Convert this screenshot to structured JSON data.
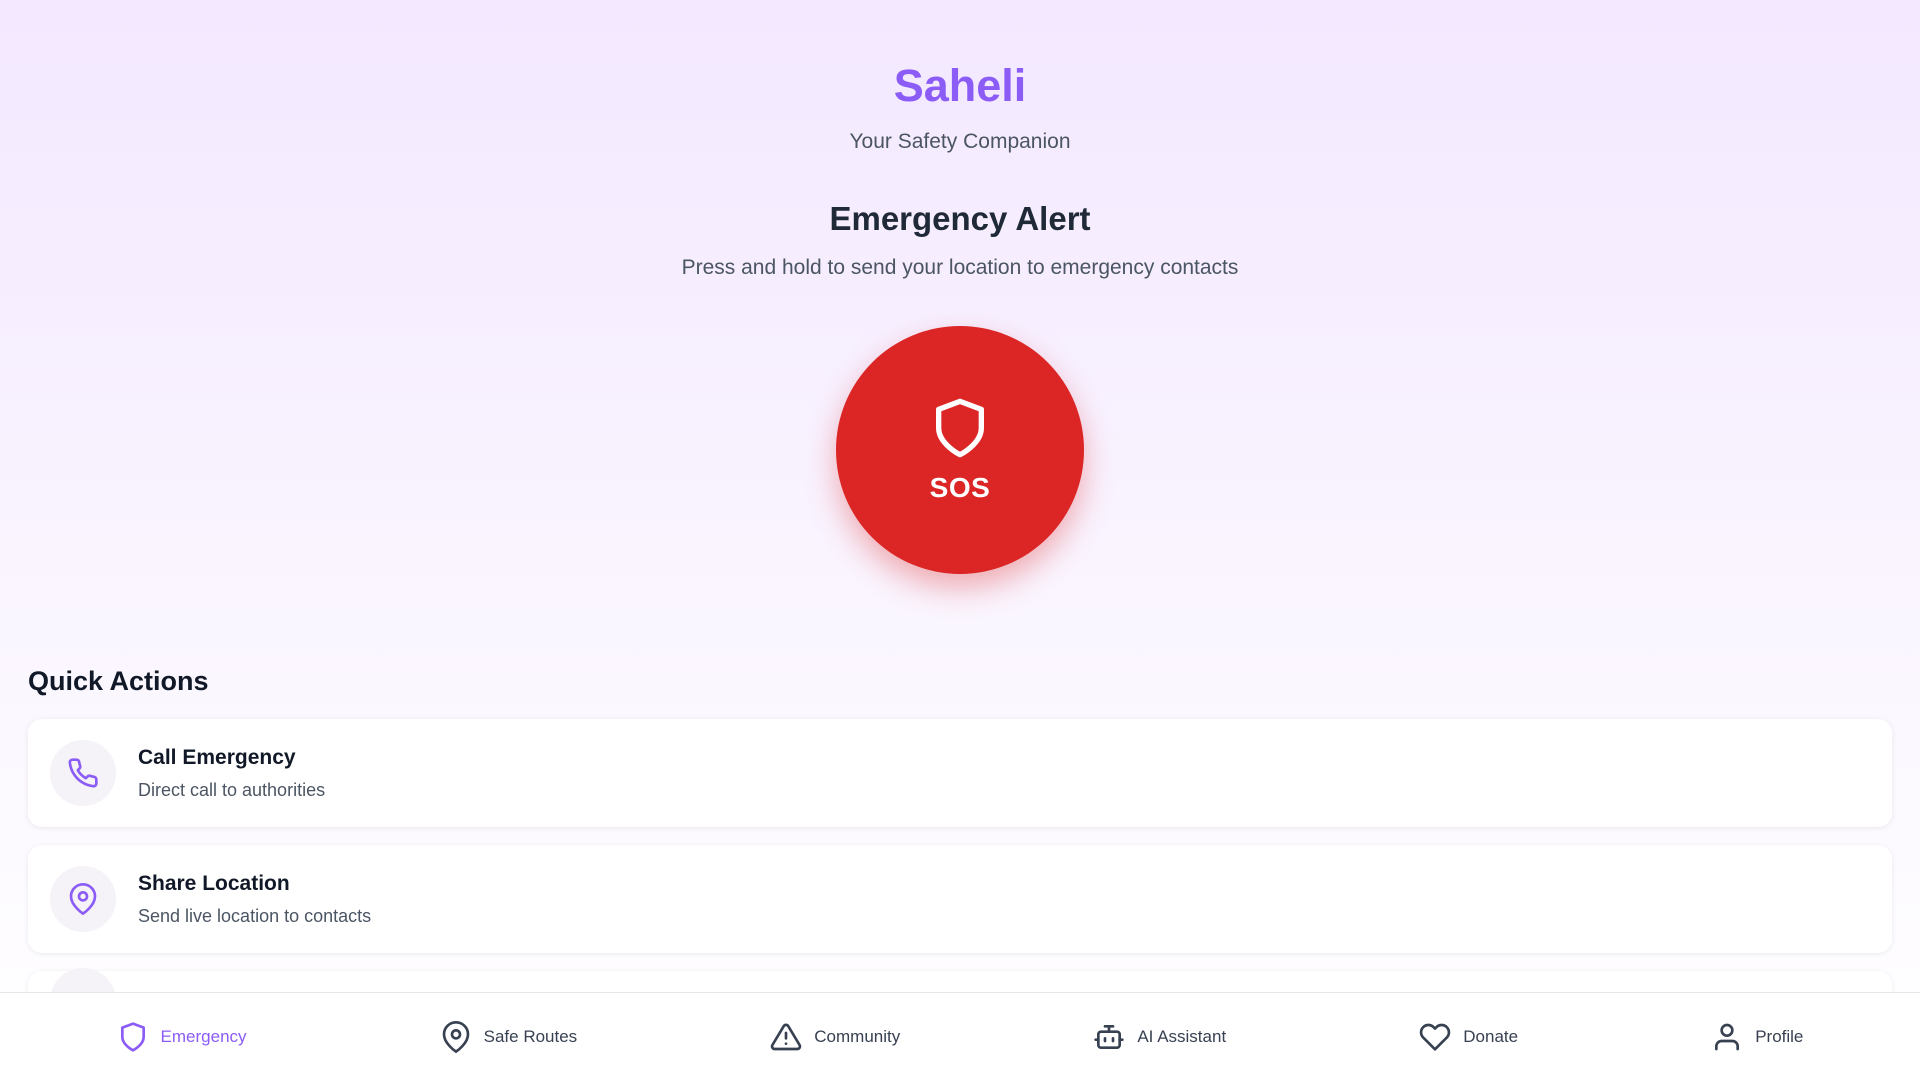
{
  "app": {
    "title": "Saheli",
    "subtitle": "Your Safety Companion"
  },
  "emergency": {
    "title": "Emergency Alert",
    "description": "Press and hold to send your location to emergency contacts",
    "sos_label": "SOS",
    "sos_icon": "shield-icon"
  },
  "quick_actions": {
    "title": "Quick Actions",
    "items": [
      {
        "title": "Call Emergency",
        "subtitle": "Direct call to authorities",
        "icon": "phone-icon"
      },
      {
        "title": "Share Location",
        "subtitle": "Send live location to contacts",
        "icon": "map-pin-icon"
      }
    ]
  },
  "nav": {
    "active": "Emergency",
    "items": [
      {
        "label": "Emergency",
        "icon": "shield-icon"
      },
      {
        "label": "Safe Routes",
        "icon": "map-pin-icon"
      },
      {
        "label": "Community",
        "icon": "alert-triangle-icon"
      },
      {
        "label": "AI Assistant",
        "icon": "bot-icon"
      },
      {
        "label": "Donate",
        "icon": "heart-icon"
      },
      {
        "label": "Profile",
        "icon": "user-icon"
      }
    ]
  },
  "colors": {
    "brand": "#8b5cf6",
    "sos": "#dc2626",
    "text": "#111827",
    "muted": "#4b5563"
  }
}
